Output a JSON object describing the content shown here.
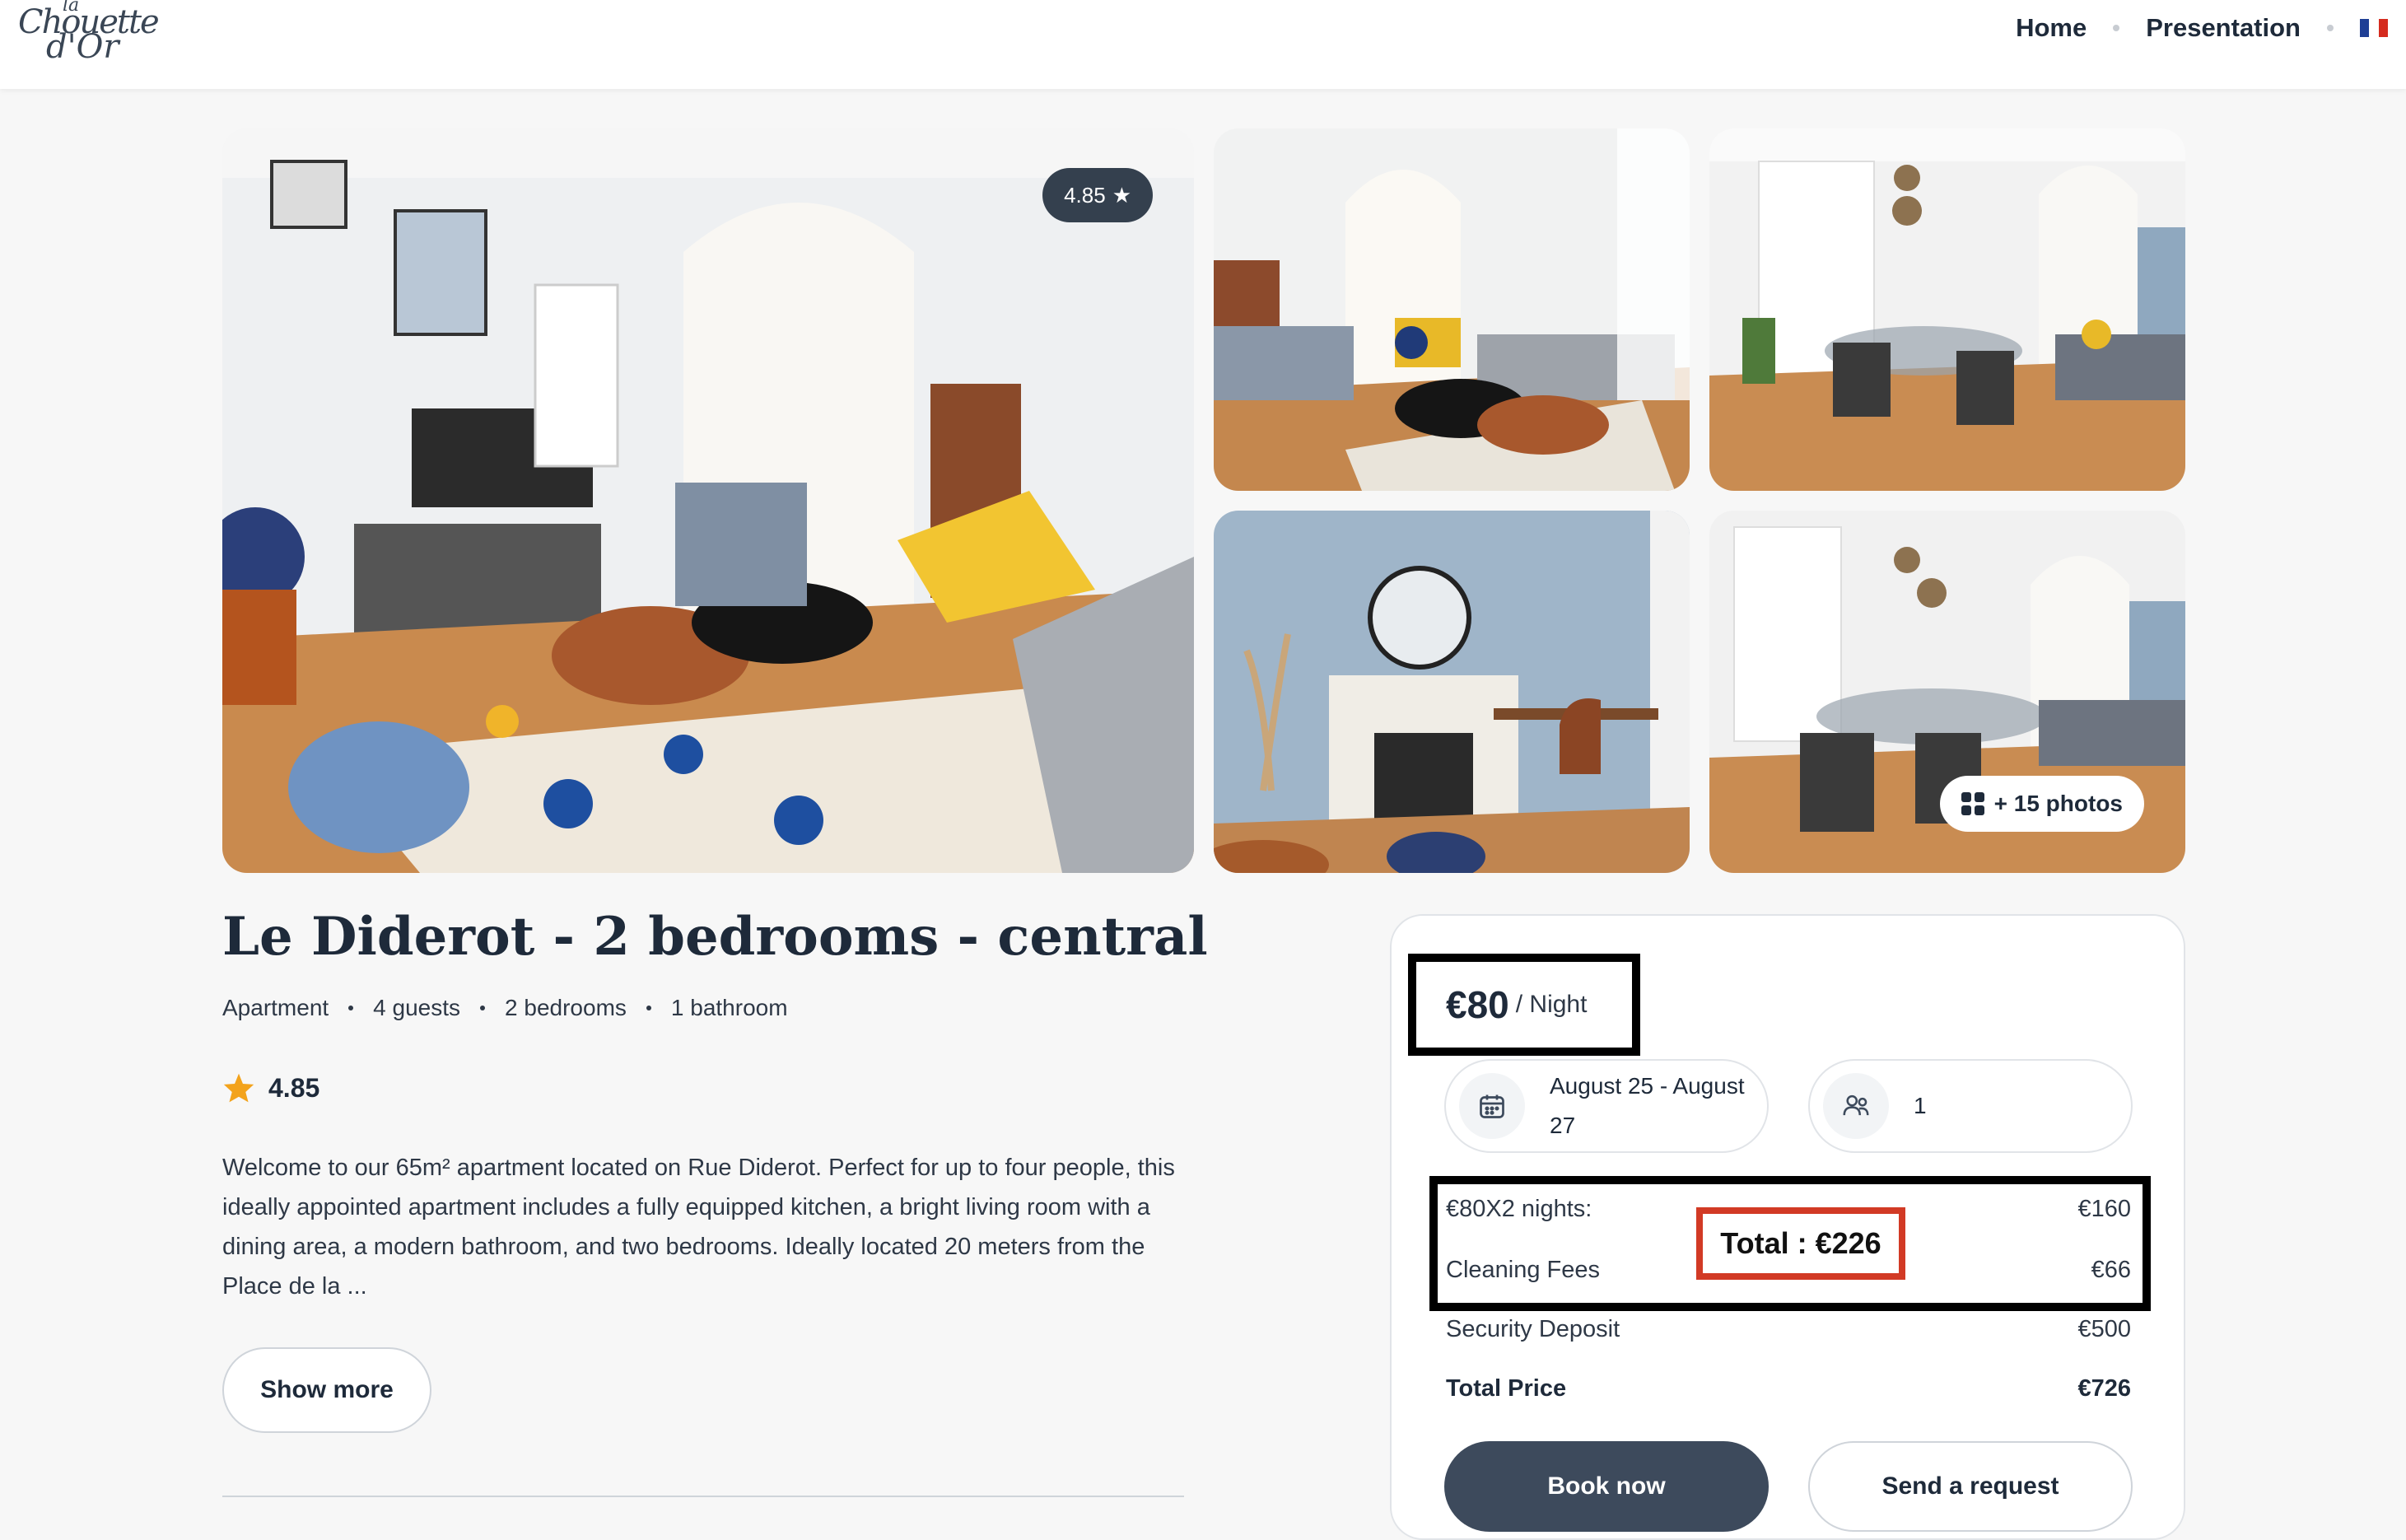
{
  "header": {
    "logo": {
      "line1": "la",
      "line2": "Chouette",
      "line3": "d'Or"
    },
    "nav": [
      {
        "label": "Home"
      },
      {
        "label": "Presentation"
      }
    ],
    "flag_colors": [
      "#1f3f95",
      "#ffffff",
      "#d52b1e"
    ]
  },
  "gallery": {
    "rating_badge": "4.85",
    "rating_badge_icon": "star-icon",
    "more_photos": "+ 15 photos",
    "more_photos_icon": "grid-icon"
  },
  "listing": {
    "title": "Le Diderot - 2 bedrooms - central",
    "meta": [
      "Apartment",
      "4 guests",
      "2 bedrooms",
      "1 bathroom"
    ],
    "rating": "4.85",
    "description": "Welcome to our 65m² apartment located on Rue Diderot. Perfect for up to four people, this ideally appointed apartment includes a fully equipped kitchen, a bright living room with a dining area, a modern bathroom, and two bedrooms. Ideally located 20 meters from the Place de la ...",
    "show_more": "Show more"
  },
  "booking": {
    "price": "€80",
    "price_unit": "/ Night",
    "dates": "August 25 - August 27",
    "guests": "1",
    "lines": [
      {
        "label": "€80X2 nights:",
        "value": "€160"
      },
      {
        "label": "Cleaning Fees",
        "value": "€66"
      },
      {
        "label": "Security Deposit",
        "value": "€500"
      },
      {
        "label": "Total Price",
        "value": "€726"
      }
    ],
    "total_overlay": "Total : €226",
    "book_now": "Book now",
    "send_request": "Send a request"
  },
  "colors": {
    "accent": "#3d4a5c",
    "highlight_red": "#d23a25",
    "star": "#f3a31c"
  }
}
